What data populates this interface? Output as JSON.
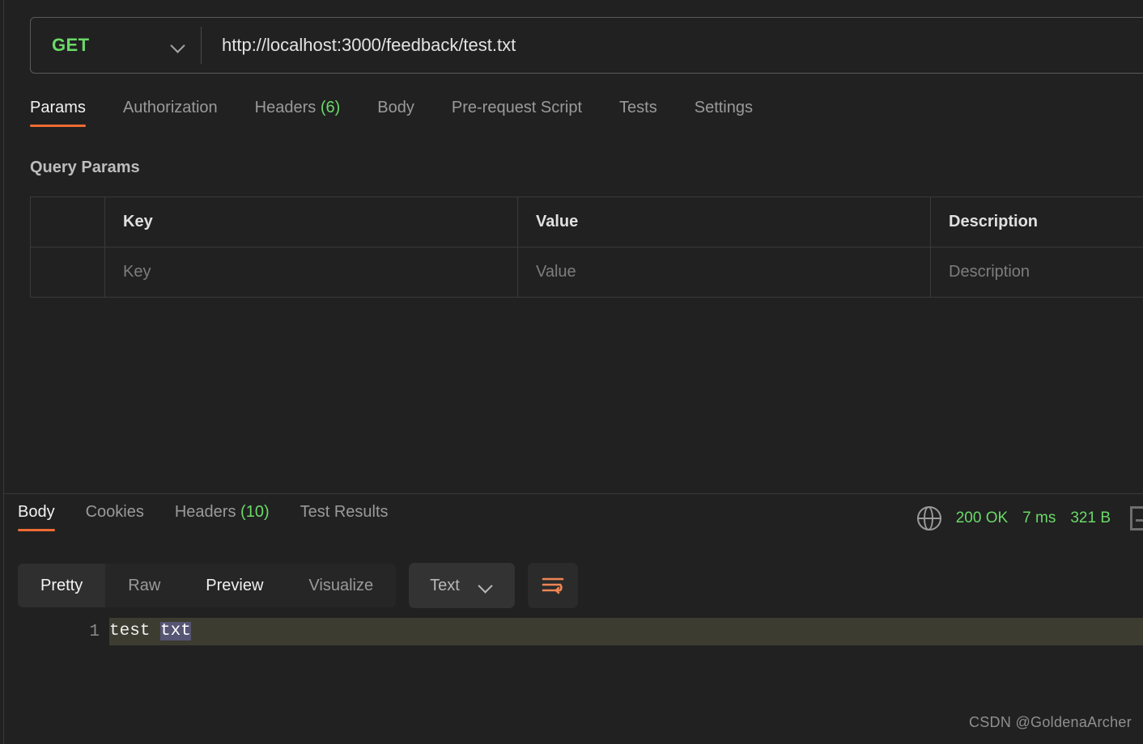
{
  "request": {
    "method": "GET",
    "method_color": "#6bd968",
    "url": "http://localhost:3000/feedback/test.txt",
    "method_dropdown_icon": "chevron-down-icon",
    "tabs": [
      {
        "label": "Params",
        "count": "",
        "active": true
      },
      {
        "label": "Authorization",
        "count": "",
        "active": false
      },
      {
        "label": "Headers",
        "count": "(6)",
        "active": false
      },
      {
        "label": "Body",
        "count": "",
        "active": false
      },
      {
        "label": "Pre-request Script",
        "count": "",
        "active": false
      },
      {
        "label": "Tests",
        "count": "",
        "active": false
      },
      {
        "label": "Settings",
        "count": "",
        "active": false
      }
    ],
    "active_tab_underline_color": "#ef6c33",
    "params": {
      "title": "Query Params",
      "columns": [
        "",
        "Key",
        "Value",
        "Description"
      ],
      "rows": [
        {
          "checkbox": "",
          "key_placeholder": "Key",
          "value_placeholder": "Value",
          "description_placeholder": "Description"
        }
      ]
    }
  },
  "response": {
    "tabs": [
      {
        "label": "Body",
        "count": "",
        "active": true
      },
      {
        "label": "Cookies",
        "count": "",
        "active": false
      },
      {
        "label": "Headers",
        "count": "(10)",
        "active": false
      },
      {
        "label": "Test Results",
        "count": "",
        "active": false
      }
    ],
    "meta": {
      "globe_icon": "globe-icon",
      "status": "200 OK",
      "time": "7 ms",
      "size": "321 B",
      "status_color": "#6bd968",
      "save_icon": "save-response-icon"
    },
    "toolbar": {
      "views": [
        {
          "label": "Pretty",
          "selected": true
        },
        {
          "label": "Raw",
          "selected": false
        },
        {
          "label": "Preview",
          "selected": false,
          "bright": true
        },
        {
          "label": "Visualize",
          "selected": false
        }
      ],
      "format": "Text",
      "format_dropdown_icon": "chevron-down-icon",
      "wrap_button_icon": "word-wrap-icon",
      "wrap_icon_color": "#ef8654"
    },
    "body": {
      "lines": [
        {
          "number": "1",
          "text_plain": "test ",
          "text_selected": "txt"
        }
      ]
    }
  },
  "watermark": "CSDN @GoldenaArcher"
}
